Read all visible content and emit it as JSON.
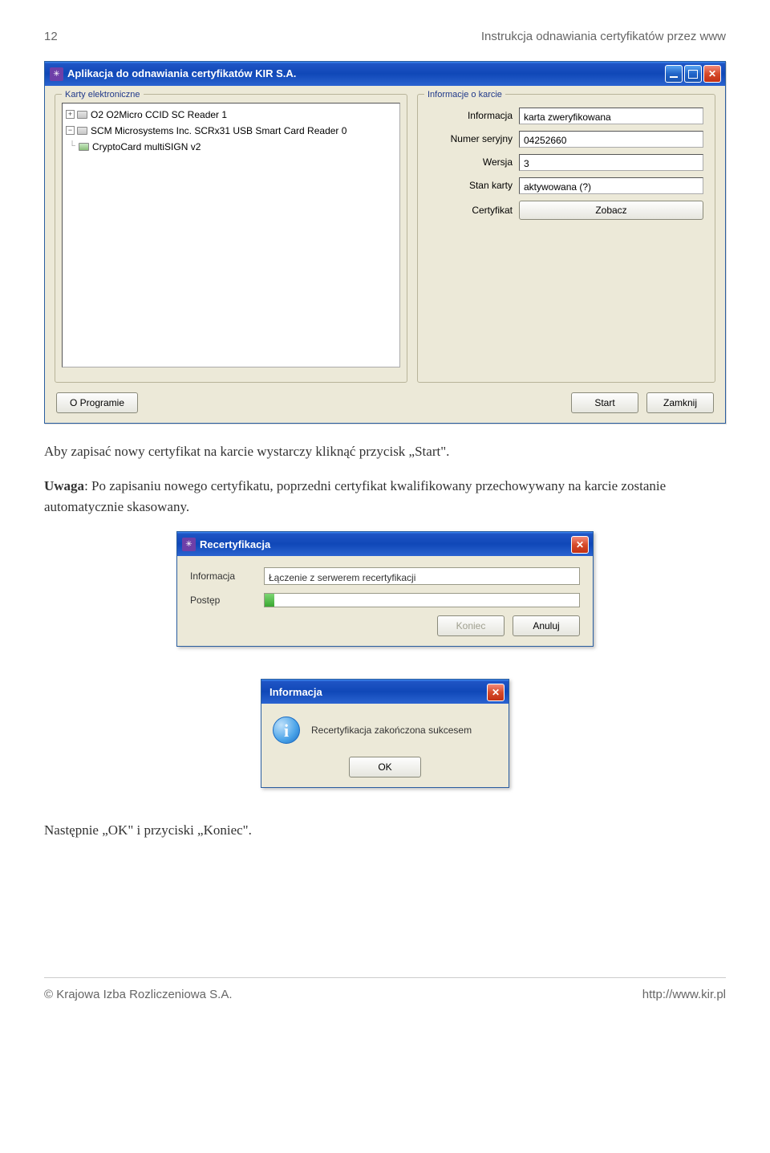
{
  "header": {
    "page_number": "12",
    "doc_title": "Instrukcja odnawiania certyfikatów przez www"
  },
  "main_window": {
    "title": "Aplikacja do odnawiania certyfikatów KIR S.A.",
    "groups": {
      "readers": "Karty elektroniczne",
      "info": "Informacje o karcie"
    },
    "tree": {
      "r0": "O2 O2Micro CCID SC Reader 1",
      "r1": "SCM Microsystems Inc. SCRx31 USB Smart Card Reader 0",
      "r1_child": "CryptoCard multiSIGN v2"
    },
    "info": {
      "l_info": "Informacja",
      "v_info": "karta zweryfikowana",
      "l_serial": "Numer seryjny",
      "v_serial": "04252660",
      "l_version": "Wersja",
      "v_version": "3",
      "l_state": "Stan karty",
      "v_state": "aktywowana (?)",
      "l_cert": "Certyfikat",
      "btn_view": "Zobacz"
    },
    "buttons": {
      "about": "O Programie",
      "start": "Start",
      "close": "Zamknij"
    }
  },
  "paragraph1": "Aby zapisać nowy certyfikat na karcie wystarczy kliknąć przycisk „Start\".",
  "paragraph2_bold": "Uwaga",
  "paragraph2_rest": ": Po zapisaniu nowego certyfikatu, poprzedni certyfikat kwalifikowany przechowywany na karcie zostanie automatycznie skasowany.",
  "recert_dialog": {
    "title": "Recertyfikacja",
    "l_info": "Informacja",
    "v_info": "Łączenie z serwerem recertyfikacji",
    "l_progress": "Postęp",
    "btn_finish": "Koniec",
    "btn_cancel": "Anuluj"
  },
  "msgbox": {
    "title": "Informacja",
    "text": "Recertyfikacja zakończona sukcesem",
    "btn_ok": "OK"
  },
  "paragraph3": "Następnie „OK\" i przyciski „Koniec\".",
  "footer": {
    "left": "© Krajowa Izba Rozliczeniowa S.A.",
    "right": "http://www.kir.pl"
  }
}
